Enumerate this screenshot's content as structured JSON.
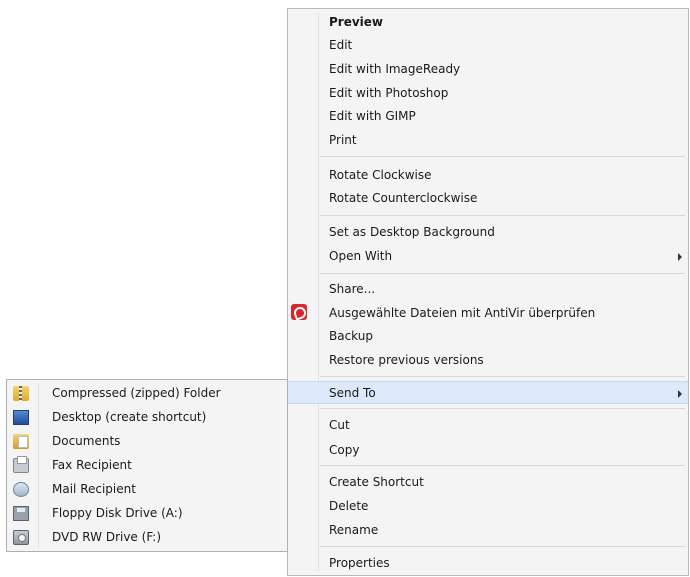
{
  "context_menu": {
    "items": [
      {
        "label": "Preview"
      },
      {
        "label": "Edit"
      },
      {
        "label": "Edit with ImageReady"
      },
      {
        "label": "Edit with Photoshop"
      },
      {
        "label": "Edit with GIMP"
      },
      {
        "label": "Print"
      },
      {
        "label": "Rotate Clockwise"
      },
      {
        "label": "Rotate Counterclockwise"
      },
      {
        "label": "Set as Desktop Background"
      },
      {
        "label": "Open With"
      },
      {
        "label": "Share..."
      },
      {
        "label": "Ausgewählte Dateien mit AntiVir überprüfen"
      },
      {
        "label": "Backup"
      },
      {
        "label": "Restore previous versions"
      },
      {
        "label": "Send To"
      },
      {
        "label": "Cut"
      },
      {
        "label": "Copy"
      },
      {
        "label": "Create Shortcut"
      },
      {
        "label": "Delete"
      },
      {
        "label": "Rename"
      },
      {
        "label": "Properties"
      }
    ]
  },
  "send_to_submenu": {
    "items": [
      {
        "label": "Compressed (zipped) Folder",
        "icon": "zip-folder-icon"
      },
      {
        "label": "Desktop (create shortcut)",
        "icon": "desktop-icon"
      },
      {
        "label": "Documents",
        "icon": "documents-folder-icon"
      },
      {
        "label": "Fax Recipient",
        "icon": "fax-icon"
      },
      {
        "label": "Mail Recipient",
        "icon": "mail-icon"
      },
      {
        "label": "Floppy Disk Drive (A:)",
        "icon": "floppy-drive-icon"
      },
      {
        "label": "DVD RW Drive (F:)",
        "icon": "dvd-drive-icon"
      }
    ]
  },
  "colors": {
    "menu_background": "#f4f4f4",
    "highlight": "#dbe9fa",
    "avira_red": "#d9262b"
  }
}
